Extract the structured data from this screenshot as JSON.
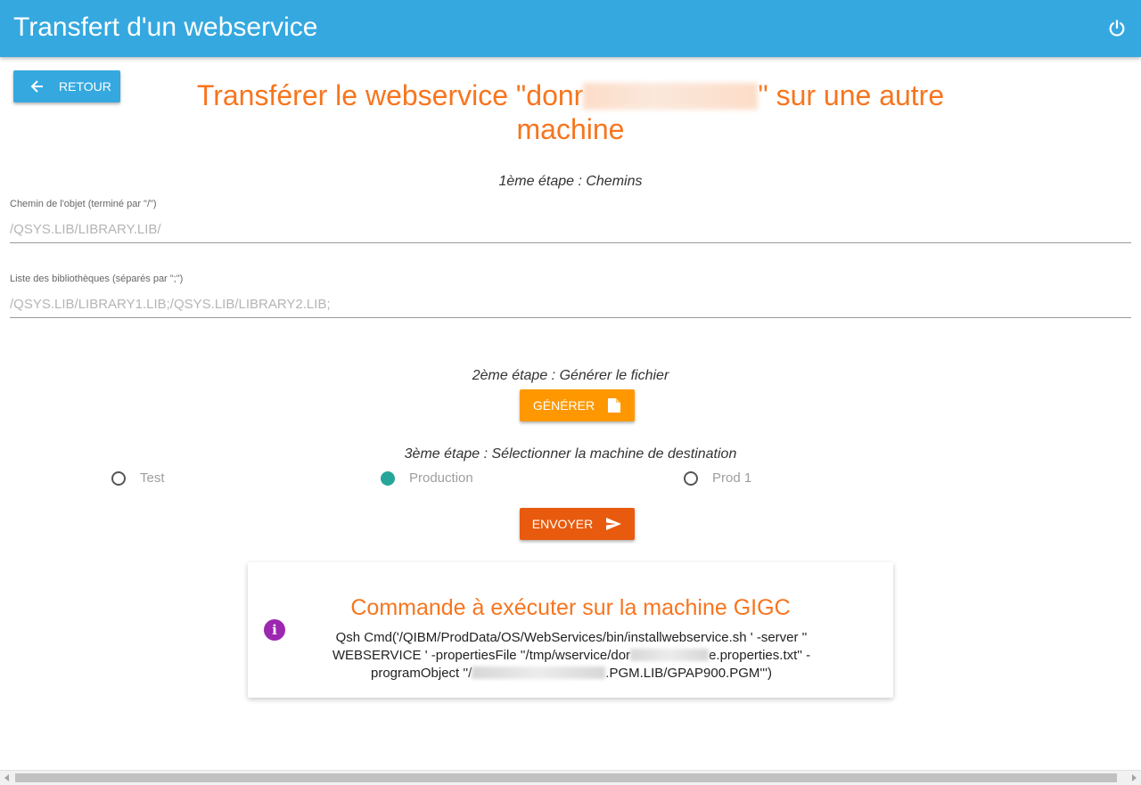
{
  "app": {
    "title": "Transfert d'un webservice"
  },
  "toolbar": {
    "back_label": "RETOUR"
  },
  "heading": {
    "before": "Transférer le webservice \"donr",
    "after": "\" sur une autre machine"
  },
  "step1": {
    "label": "1ème étape : Chemins",
    "object_path": {
      "label": "Chemin de l'objet (terminé par \"/\")",
      "placeholder": "/QSYS.LIB/LIBRARY.LIB/",
      "value": ""
    },
    "libraries": {
      "label": "Liste des bibliothèques (séparés par \";\")",
      "placeholder": "/QSYS.LIB/LIBRARY1.LIB;/QSYS.LIB/LIBRARY2.LIB;",
      "value": ""
    }
  },
  "step2": {
    "label": "2ème étape : Générer le fichier",
    "generate_label": "GÉNÉRER"
  },
  "step3": {
    "label": "3ème étape : Sélectionner la machine de destination",
    "options": [
      {
        "label": "Test",
        "selected": false
      },
      {
        "label": "Production",
        "selected": true
      },
      {
        "label": "Prod 1",
        "selected": false
      }
    ],
    "send_label": "ENVOYER"
  },
  "command_card": {
    "title": "Commande à exécuter sur la machine GIGC",
    "info_glyph": "i",
    "line1": "Qsh Cmd('/QIBM/ProdData/OS/WebServices/bin/installwebservice.sh ' -server ''",
    "line2_a": "WEBSERVICE ' -propertiesFile ''/tmp/wservice/dor",
    "line2_b": "e.properties.txt'' -",
    "line3_a": "programObject ''/",
    "line3_b": ".PGM.LIB/GPAP900.PGM''')"
  },
  "colors": {
    "topbar": "#35a8e0",
    "accent_orange": "#f7751e",
    "generate": "#ff9800",
    "send": "#e85a0e",
    "radio_selected": "#26a69a",
    "info": "#9c27b0"
  },
  "icons": {
    "power": "power-icon",
    "back": "arrow-left-icon",
    "generate": "file-icon",
    "send": "send-icon",
    "info": "info-icon"
  }
}
